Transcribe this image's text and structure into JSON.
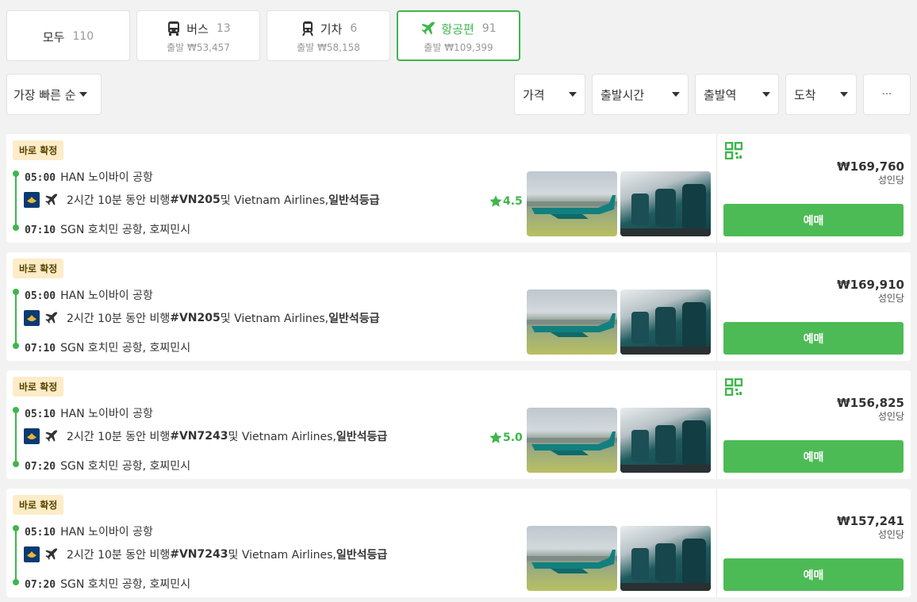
{
  "tabs": [
    {
      "label": "모두",
      "count": "110",
      "sub": ""
    },
    {
      "label": "버스",
      "count": "13",
      "sub": "출발 ₩53,457"
    },
    {
      "label": "기차",
      "count": "6",
      "sub": "출발 ₩58,158"
    },
    {
      "label": "항공편",
      "count": "91",
      "sub": "출발 ₩109,399"
    }
  ],
  "sort": {
    "label": "가장 빠른 순"
  },
  "filters": {
    "price": "가격",
    "departure_time": "출발시간",
    "departure_station": "출발역",
    "arrival": "도착",
    "more": "···"
  },
  "colors": {
    "accent": "#3fb64c",
    "badge_bg": "#fdecc8"
  },
  "results": [
    {
      "badge": "바로 확정",
      "dep_time": "05:00",
      "dep_place": "HAN 노이바이 공항",
      "summary_pre": "2시간 10분 동안 비행 ",
      "flight": "#VN205",
      "summary_mid": " 및 Vietnam Airlines, ",
      "class": "일반석등급",
      "arr_time": "07:10",
      "arr_place": "SGN 호치민 공항, 호찌민시",
      "rating": "4.5",
      "price": "₩169,760",
      "per": "성인당",
      "buy": "예매",
      "qr": true
    },
    {
      "badge": "바로 확정",
      "dep_time": "05:00",
      "dep_place": "HAN 노이바이 공항",
      "summary_pre": "2시간 10분 동안 비행 ",
      "flight": "#VN205",
      "summary_mid": " 및 Vietnam Airlines, ",
      "class": "일반석등급",
      "arr_time": "07:10",
      "arr_place": "SGN 호치민 공항, 호찌민시",
      "rating": "",
      "price": "₩169,910",
      "per": "성인당",
      "buy": "예매",
      "qr": false
    },
    {
      "badge": "바로 확정",
      "dep_time": "05:10",
      "dep_place": "HAN 노이바이 공항",
      "summary_pre": "2시간 10분 동안 비행 ",
      "flight": "#VN7243",
      "summary_mid": " 및 Vietnam Airlines, ",
      "class": "일반석등급",
      "arr_time": "07:20",
      "arr_place": "SGN 호치민 공항, 호찌민시",
      "rating": "5.0",
      "price": "₩156,825",
      "per": "성인당",
      "buy": "예매",
      "qr": true
    },
    {
      "badge": "바로 확정",
      "dep_time": "05:10",
      "dep_place": "HAN 노이바이 공항",
      "summary_pre": "2시간 10분 동안 비행 ",
      "flight": "#VN7243",
      "summary_mid": " 및 Vietnam Airlines, ",
      "class": "일반석등급",
      "arr_time": "07:20",
      "arr_place": "SGN 호치민 공항, 호찌민시",
      "rating": "",
      "price": "₩157,241",
      "per": "성인당",
      "buy": "예매",
      "qr": false
    }
  ]
}
